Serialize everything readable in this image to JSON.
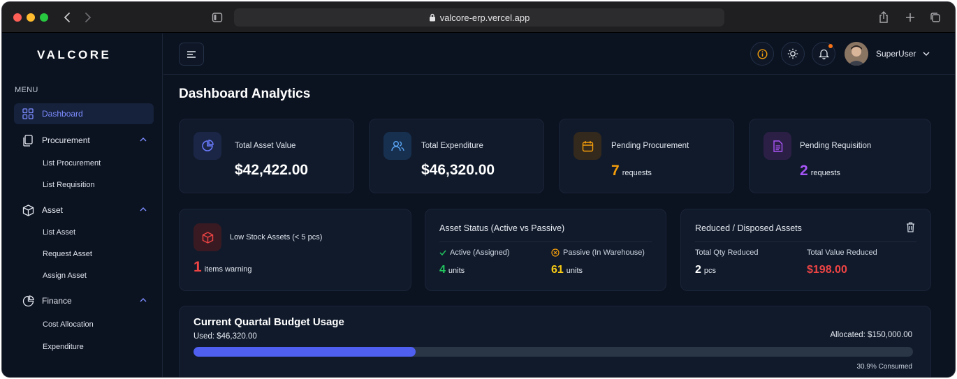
{
  "browser": {
    "url": "valcore-erp.vercel.app"
  },
  "sidebar": {
    "logo": "VALCORE",
    "menu_label": "MENU",
    "dashboard": "Dashboard",
    "procurement": {
      "label": "Procurement",
      "items": [
        "List Procurement",
        "List Requisition"
      ]
    },
    "asset": {
      "label": "Asset",
      "items": [
        "List Asset",
        "Request Asset",
        "Assign Asset"
      ]
    },
    "finance": {
      "label": "Finance",
      "items": [
        "Cost Allocation",
        "Expenditure"
      ]
    }
  },
  "header": {
    "username": "SuperUser"
  },
  "page": {
    "title": "Dashboard Analytics"
  },
  "stats": {
    "total_asset": {
      "label": "Total Asset Value",
      "value": "$42,422.00"
    },
    "total_expenditure": {
      "label": "Total Expenditure",
      "value": "$46,320.00"
    },
    "pending_procurement": {
      "label": "Pending Procurement",
      "count": "7",
      "unit": "requests"
    },
    "pending_requisition": {
      "label": "Pending Requisition",
      "count": "2",
      "unit": "requests"
    }
  },
  "low_stock": {
    "label": "Low Stock Assets (< 5 pcs)",
    "count": "1",
    "unit": "items warning"
  },
  "asset_status": {
    "title": "Asset Status (Active vs Passive)",
    "active_label": "Active (Assigned)",
    "active_count": "4",
    "active_unit": "units",
    "passive_label": "Passive (In Warehouse)",
    "passive_count": "61",
    "passive_unit": "units"
  },
  "reduced": {
    "title": "Reduced / Disposed Assets",
    "qty_label": "Total Qty Reduced",
    "qty_value": "2",
    "qty_unit": "pcs",
    "value_label": "Total Value Reduced",
    "value_value": "$198.00"
  },
  "budget": {
    "title": "Current Quartal Budget Usage",
    "used": "Used: $46,320.00",
    "allocated": "Allocated: $150,000.00",
    "consumed": "30.9% Consumed",
    "progress_percent": 30.9
  },
  "colors": {
    "accent": "#4f5ff0",
    "orange": "#f59e0b",
    "purple": "#a855f7",
    "red": "#ef4444",
    "green": "#22c55e",
    "yellow": "#facc15"
  }
}
